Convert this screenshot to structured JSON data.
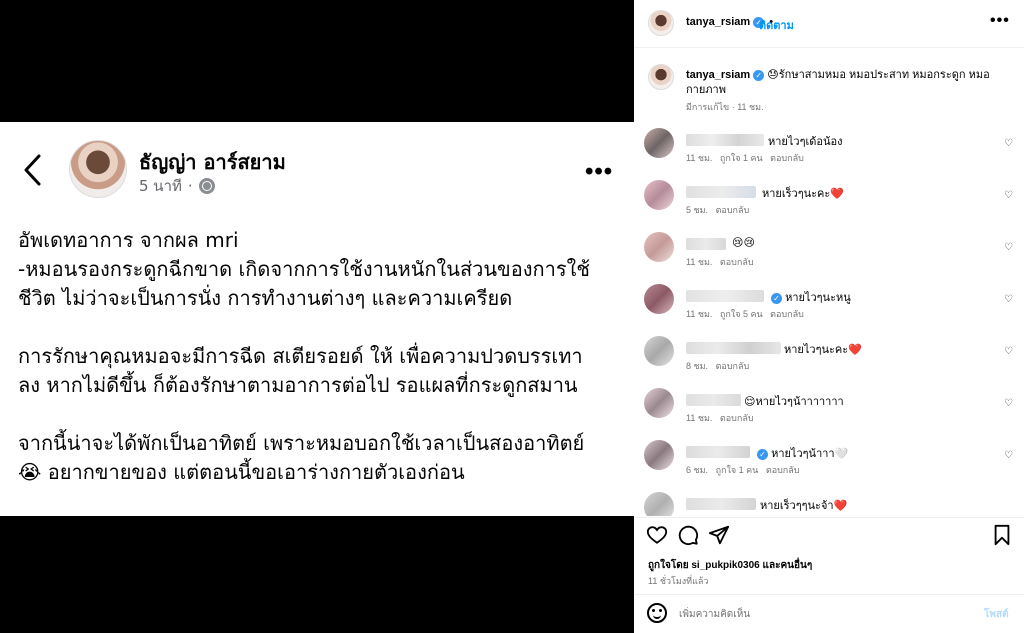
{
  "facebook_post": {
    "author": "ธัญญ่า อาร์สยาม",
    "time": "5 นาที",
    "time_separator": "·",
    "more": "•••",
    "paragraphs": [
      [
        "อัพเดทอาการ จากผล mri",
        "-หมอนรองกระดูกฉีกขาด เกิดจากการใช้งานหนักในส่วนของการใช้",
        "ชีวิต ไม่ว่าจะเป็นการนั่ง การทำงานต่างๆ และความเครียด"
      ],
      [
        "การรักษาคุณหมอจะมีการฉีด สเตียรอยด์ ให้ เพื่อความปวดบรรเทา",
        "ลง หากไม่ดีขึ้น ก็ต้องรักษาตามอาการต่อไป รอแผลที่กระดูกสมาน"
      ],
      [
        "จากนี้น่าจะได้พักเป็นอาทิตย์ เพราะหมอบอกใช้เวลาเป็นสองอาทิตย์",
        "😭 อยากขายของ แต่ตอนนี้ขอเอาร่างกายตัวเองก่อน"
      ]
    ]
  },
  "instagram": {
    "username": "tanya_rsiam",
    "verified_mark": "✓",
    "dot": "•",
    "follow": "ติดตาม",
    "more": "•••",
    "caption_text": "😓รักษาสามหมอ หมอประสาท หมอกระดูก หมอกายภาพ",
    "caption_meta": "มีการแก้ไข · 11 ชม.",
    "comments": [
      {
        "text": "หายไวๆเด้อน้อง",
        "time": "11 ชม.",
        "likes": "ถูกใจ 1 คน",
        "reply": "ตอบกลับ"
      },
      {
        "text": "หายเร็วๆนะคะ❤️",
        "time": "5 ชม.",
        "likes": "",
        "reply": "ตอบกลับ"
      },
      {
        "text": "😢😢",
        "time": "11 ชม.",
        "likes": "",
        "reply": "ตอบกลับ"
      },
      {
        "text": "หายไวๆนะหนู",
        "time": "11 ชม.",
        "likes": "ถูกใจ 5 คน",
        "reply": "ตอบกลับ"
      },
      {
        "text": "หายไวๆนะคะ❤️",
        "time": "8 ชม.",
        "likes": "",
        "reply": "ตอบกลับ"
      },
      {
        "text": "😌หายไวๆน้าาาาาาา",
        "time": "11 ชม.",
        "likes": "",
        "reply": "ตอบกลับ"
      },
      {
        "text": "หายไวๆน้าาา🤍",
        "time": "6 ชม.",
        "likes": "ถูกใจ 1 คน",
        "reply": "ตอบกลับ"
      },
      {
        "text": "หายเร็วๆๆนะจ้า❤️",
        "time": "",
        "likes": "",
        "reply": ""
      }
    ],
    "liked_by": "ถูกใจโดย si_pukpik0306 และคนอื่นๆ",
    "post_time": "11 ชั่วโมงที่แล้ว",
    "comment_placeholder": "เพิ่มความคิดเห็น",
    "post_button": "โพสต์"
  }
}
